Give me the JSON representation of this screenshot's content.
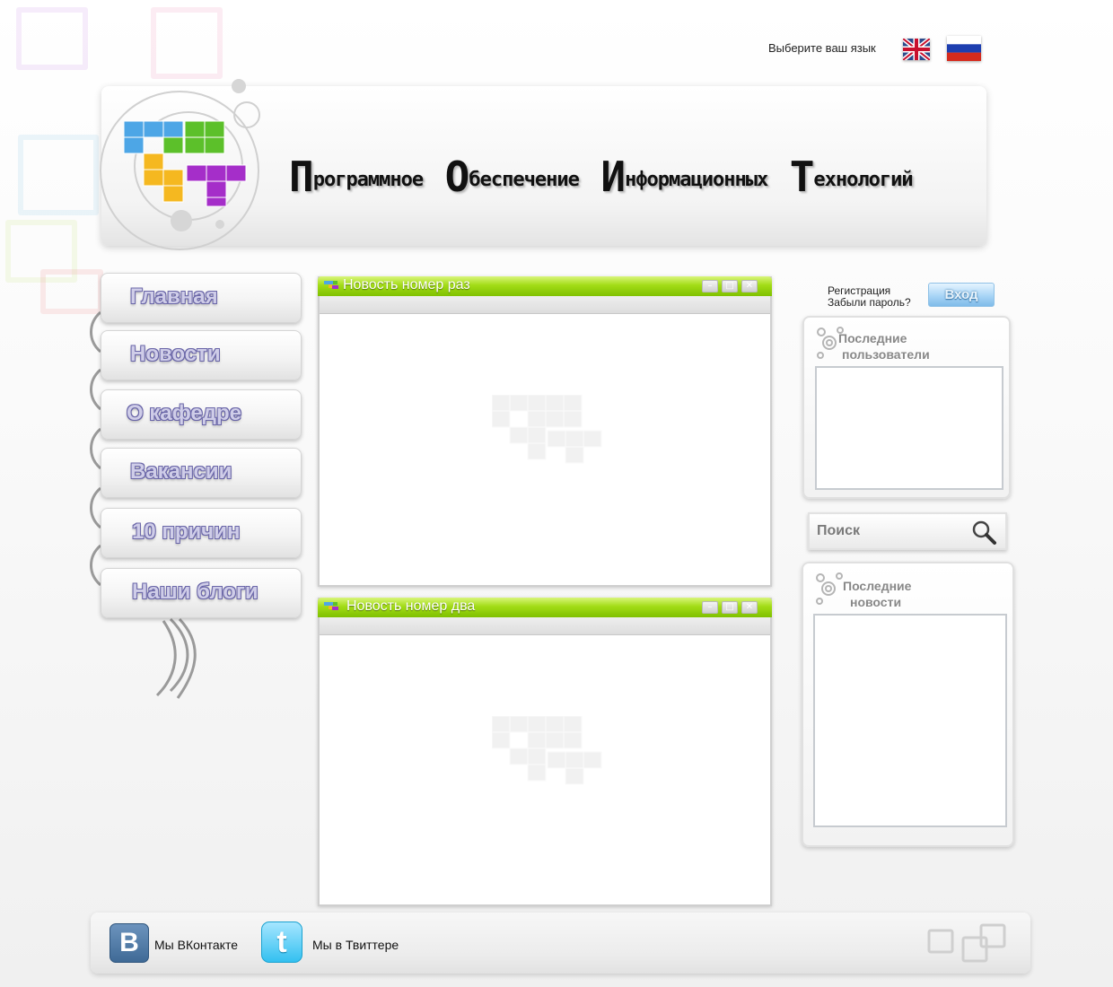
{
  "language": {
    "label": "Выберите ваш язык",
    "options": [
      "english-flag",
      "russian-flag"
    ]
  },
  "header": {
    "title_words": [
      {
        "cap": "П",
        "rest": "рограммное"
      },
      {
        "cap": "О",
        "rest": "беспечение"
      },
      {
        "cap": "И",
        "rest": "нформационных"
      },
      {
        "cap": "Т",
        "rest": "ехнологий"
      }
    ]
  },
  "nav": {
    "items": [
      "Главная",
      "Новости",
      "О кафедре",
      "Вакансии",
      "10 причин",
      "Наши блоги"
    ]
  },
  "news": {
    "windows": [
      {
        "title": "Новость номер раз"
      },
      {
        "title": "Новость номер два"
      }
    ]
  },
  "auth": {
    "register": "Регистрация",
    "forgot": "Забыли пароль?",
    "login": "Вход"
  },
  "sidebar": {
    "recent_users_line1": "Последние",
    "recent_users_line2": "пользователи",
    "recent_news_line1": "Последние",
    "recent_news_line2": "новости"
  },
  "search": {
    "placeholder": "Поиск"
  },
  "footer": {
    "vk": "Мы ВКонтакте",
    "twitter": "Мы в Твиттере"
  },
  "colors": {
    "titlebar_green": "#8fd000",
    "nav_text": "#6a66a8",
    "login_blue": "#7fbbe9"
  }
}
